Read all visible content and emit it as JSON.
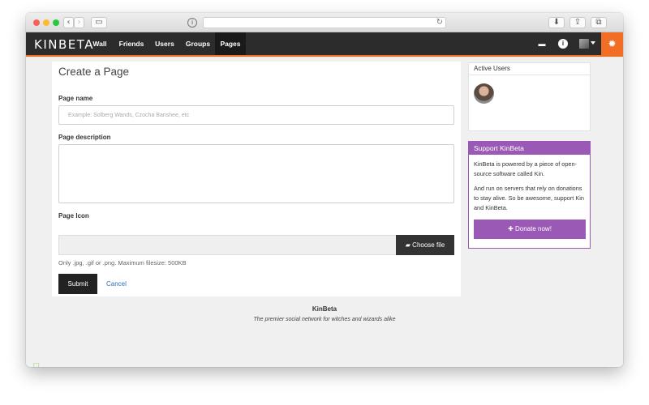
{
  "browser": {
    "back_icon": "chevron-left-icon",
    "forward_icon": "chevron-right-icon",
    "info_glyph": "i"
  },
  "navbar": {
    "logo": "KINBETA",
    "items": [
      "Wall",
      "Friends",
      "Users",
      "Groups",
      "Pages"
    ],
    "active": "Pages",
    "accent": "#f26e24"
  },
  "form": {
    "title": "Create a Page",
    "name_label": "Page name",
    "name_placeholder": "Example: Solberg Wands, Czocha Banshee, etc",
    "desc_label": "Page description",
    "icon_label": "Page Icon",
    "choose_label": "Choose file",
    "help": "Only .jpg, .gif or .png. Maximum filesize: 500KB",
    "submit": "Submit",
    "cancel": "Cancel"
  },
  "sidebar": {
    "active_users_title": "Active Users",
    "support_title": "Support KinBeta",
    "support_p1": "KinBeta is powered by a piece of open-source software called Kin.",
    "support_p2": "And run on servers that rely on donations to stay alive. So be awesome, support Kin and KinBeta.",
    "donate": "Donate now!",
    "accent": "#9b59b6"
  },
  "footer": {
    "title": "KinBeta",
    "subtitle": "The premier social network for witches and wizards alike"
  }
}
